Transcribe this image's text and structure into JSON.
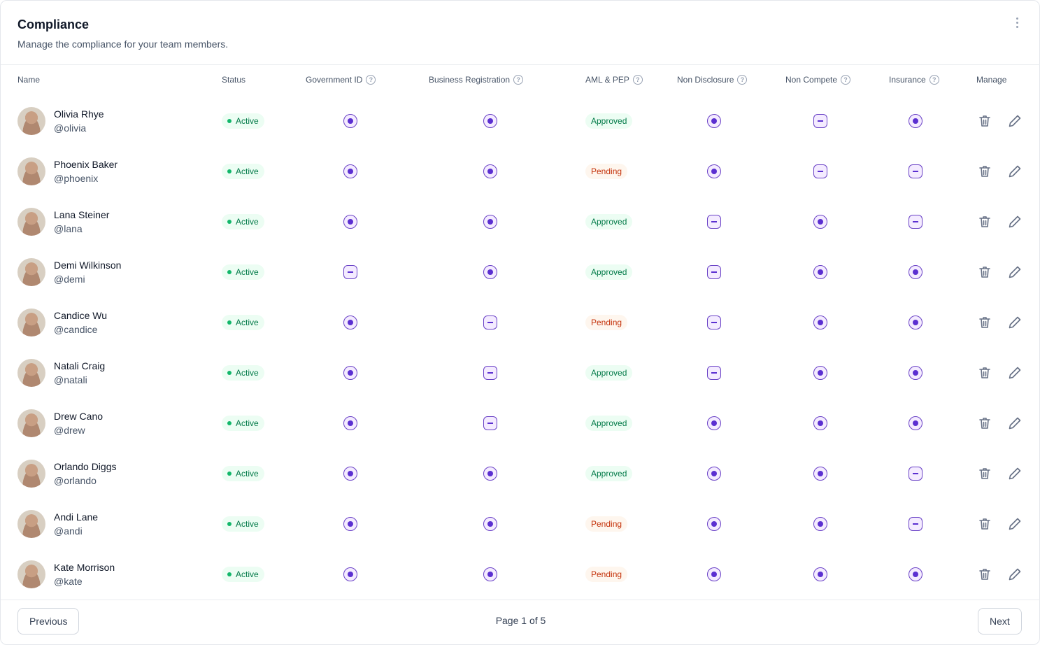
{
  "header": {
    "title": "Compliance",
    "subtitle": "Manage the compliance for your team members."
  },
  "columns": {
    "name": "Name",
    "status": "Status",
    "government_id": "Government ID",
    "business_registration": "Business Registration",
    "aml_pep": "AML & PEP",
    "non_disclosure": "Non Disclosure",
    "non_compete": "Non Compete",
    "insurance": "Insurance",
    "manage": "Manage"
  },
  "help_glyph": "?",
  "rows": [
    {
      "name": "Olivia Rhye",
      "handle": "@olivia",
      "status": "Active",
      "government_id": "check",
      "business_registration": "check",
      "aml_pep": "Approved",
      "non_disclosure": "check",
      "non_compete": "minus",
      "insurance": "check"
    },
    {
      "name": "Phoenix Baker",
      "handle": "@phoenix",
      "status": "Active",
      "government_id": "check",
      "business_registration": "check",
      "aml_pep": "Pending",
      "non_disclosure": "check",
      "non_compete": "minus",
      "insurance": "minus"
    },
    {
      "name": "Lana Steiner",
      "handle": "@lana",
      "status": "Active",
      "government_id": "check",
      "business_registration": "check",
      "aml_pep": "Approved",
      "non_disclosure": "minus",
      "non_compete": "check",
      "insurance": "minus"
    },
    {
      "name": "Demi Wilkinson",
      "handle": "@demi",
      "status": "Active",
      "government_id": "minus",
      "business_registration": "check",
      "aml_pep": "Approved",
      "non_disclosure": "minus",
      "non_compete": "check",
      "insurance": "check"
    },
    {
      "name": "Candice Wu",
      "handle": "@candice",
      "status": "Active",
      "government_id": "check",
      "business_registration": "minus",
      "aml_pep": "Pending",
      "non_disclosure": "minus",
      "non_compete": "check",
      "insurance": "check"
    },
    {
      "name": "Natali Craig",
      "handle": "@natali",
      "status": "Active",
      "government_id": "check",
      "business_registration": "minus",
      "aml_pep": "Approved",
      "non_disclosure": "minus",
      "non_compete": "check",
      "insurance": "check"
    },
    {
      "name": "Drew Cano",
      "handle": "@drew",
      "status": "Active",
      "government_id": "check",
      "business_registration": "minus",
      "aml_pep": "Approved",
      "non_disclosure": "check",
      "non_compete": "check",
      "insurance": "check"
    },
    {
      "name": "Orlando Diggs",
      "handle": "@orlando",
      "status": "Active",
      "government_id": "check",
      "business_registration": "check",
      "aml_pep": "Approved",
      "non_disclosure": "check",
      "non_compete": "check",
      "insurance": "minus"
    },
    {
      "name": "Andi Lane",
      "handle": "@andi",
      "status": "Active",
      "government_id": "check",
      "business_registration": "check",
      "aml_pep": "Pending",
      "non_disclosure": "check",
      "non_compete": "check",
      "insurance": "minus"
    },
    {
      "name": "Kate Morrison",
      "handle": "@kate",
      "status": "Active",
      "government_id": "check",
      "business_registration": "check",
      "aml_pep": "Pending",
      "non_disclosure": "check",
      "non_compete": "check",
      "insurance": "check"
    }
  ],
  "pagination": {
    "previous": "Previous",
    "page_label": "Page 1 of 5",
    "next": "Next"
  },
  "colors": {
    "accent": "#6941c6",
    "success": "#027a48",
    "warning": "#c4320a"
  }
}
